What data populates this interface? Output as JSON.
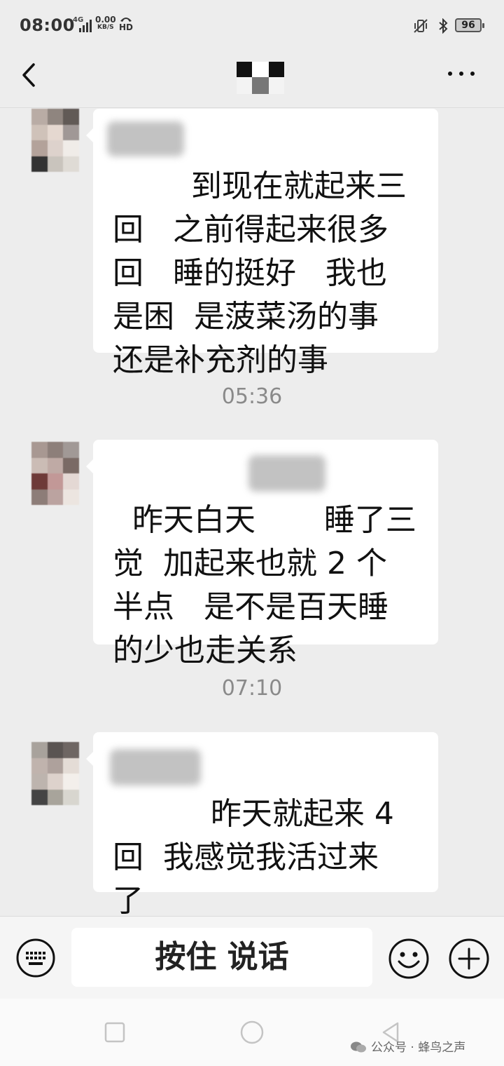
{
  "status_bar": {
    "time": "08:00",
    "network": "4G",
    "speed_value": "0.00",
    "speed_unit": "KB/S",
    "hd": "HD",
    "battery": "96"
  },
  "chat": {
    "messages": [
      {
        "text": "      到现在就起来三\n回   之前得起来很多\n回   睡的挺好   我也\n是困  是菠菜汤的事\n还是补充剂的事"
      },
      {
        "text": "昨天白天       睡了三\n觉  加起来也就 2 个\n半点   是不是百天睡\n的少也走关系"
      },
      {
        "text": "        昨天就起来 4\n回  我感觉我活过来\n了"
      }
    ],
    "timestamps": [
      "05:36",
      "07:10"
    ]
  },
  "input_bar": {
    "hold_to_talk": "按住 说话"
  },
  "watermark": {
    "text": "公众号 · 蜂鸟之声"
  },
  "colors": {
    "background": "#ededed",
    "bubble": "#ffffff",
    "timestamp": "#8a8a8a"
  },
  "icons": [
    "back-arrow-icon",
    "more-icon",
    "keyboard-icon",
    "emoji-icon",
    "plus-icon",
    "square-icon",
    "circle-icon",
    "triangle-icon",
    "wechat-icon"
  ]
}
